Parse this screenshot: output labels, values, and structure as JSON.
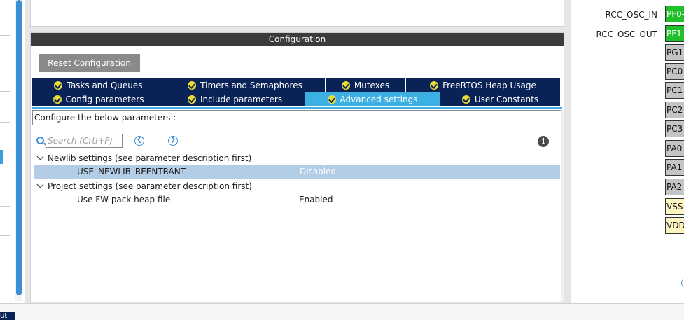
{
  "config": {
    "title": "Configuration",
    "reset_label": "Reset Configuration",
    "tabs_row1": [
      {
        "label": "Tasks and Queues"
      },
      {
        "label": "Timers and Semaphores"
      },
      {
        "label": "Mutexes"
      },
      {
        "label": "FreeRTOS Heap Usage"
      }
    ],
    "tabs_row2": [
      {
        "label": "Config parameters"
      },
      {
        "label": "Include parameters"
      },
      {
        "label": "Advanced settings",
        "active": true
      },
      {
        "label": "User Constants"
      }
    ],
    "configure_text": "Configure the below parameters :",
    "search_placeholder": "Search (Crtl+F)",
    "groups": [
      {
        "label": "Newlib settings (see parameter description first)",
        "params": [
          {
            "name": "USE_NEWLIB_REENTRANT",
            "value": "Disabled",
            "selected": true
          }
        ]
      },
      {
        "label": "Project settings (see parameter description first)",
        "params": [
          {
            "name": "Use FW pack heap file",
            "value": "Enabled",
            "selected": false
          }
        ]
      }
    ]
  },
  "pinout": {
    "signals": [
      "RCC_OSC_IN",
      "RCC_OSC_OUT"
    ],
    "pins": [
      {
        "label": "PF0-",
        "color": "green"
      },
      {
        "label": "PF1-",
        "color": "green"
      },
      {
        "label": "PG1",
        "color": "gray"
      },
      {
        "label": "PC0",
        "color": "gray"
      },
      {
        "label": "PC1",
        "color": "gray"
      },
      {
        "label": "PC2",
        "color": "gray"
      },
      {
        "label": "PC3",
        "color": "gray"
      },
      {
        "label": "PA0",
        "color": "gray"
      },
      {
        "label": "PA1",
        "color": "gray"
      },
      {
        "label": "PA2",
        "color": "gray"
      },
      {
        "label": "VSS",
        "color": "yellow"
      },
      {
        "label": "VDD",
        "color": "yellow"
      }
    ]
  },
  "bottom": {
    "chip_label": "ut"
  },
  "colors": {
    "tab_bg": "#0a2357",
    "tab_active": "#3cb0e3",
    "check_yellow": "#e8dc3a",
    "pin_green": "#1fc02a",
    "row_selected": "#b4cde6"
  }
}
